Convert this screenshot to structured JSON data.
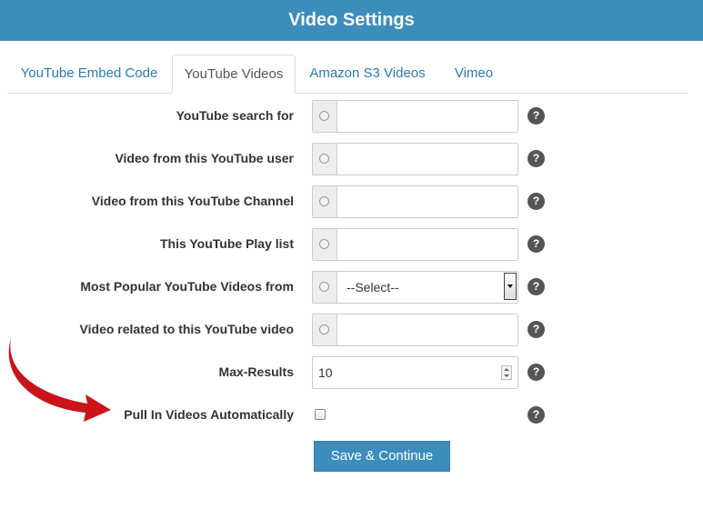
{
  "header": {
    "title": "Video Settings"
  },
  "tabs": [
    {
      "label": "YouTube Embed Code",
      "active": false
    },
    {
      "label": "YouTube Videos",
      "active": true
    },
    {
      "label": "Amazon S3 Videos",
      "active": false
    },
    {
      "label": "Vimeo",
      "active": false
    }
  ],
  "form": {
    "rows": [
      {
        "label": "YouTube search for",
        "value": ""
      },
      {
        "label": "Video from this YouTube user",
        "value": ""
      },
      {
        "label": "Video from this YouTube Channel",
        "value": ""
      },
      {
        "label": "This YouTube Play list",
        "value": ""
      },
      {
        "label": "Most Popular YouTube Videos from",
        "selected": "--Select--"
      },
      {
        "label": "Video related to this YouTube video",
        "value": ""
      }
    ],
    "max_results": {
      "label": "Max-Results",
      "value": "10"
    },
    "auto_pull": {
      "label": "Pull In Videos Automatically",
      "checked": false
    },
    "help_symbol": "?",
    "save_label": "Save & Continue"
  },
  "colors": {
    "header": "#3c8dbc",
    "button": "#3c8dbc",
    "arrow": "#c8141a",
    "link": "#2a7ab8"
  },
  "icons": {
    "help": "help-icon",
    "radio": "radio-icon",
    "arrow": "arrow-annotation"
  }
}
